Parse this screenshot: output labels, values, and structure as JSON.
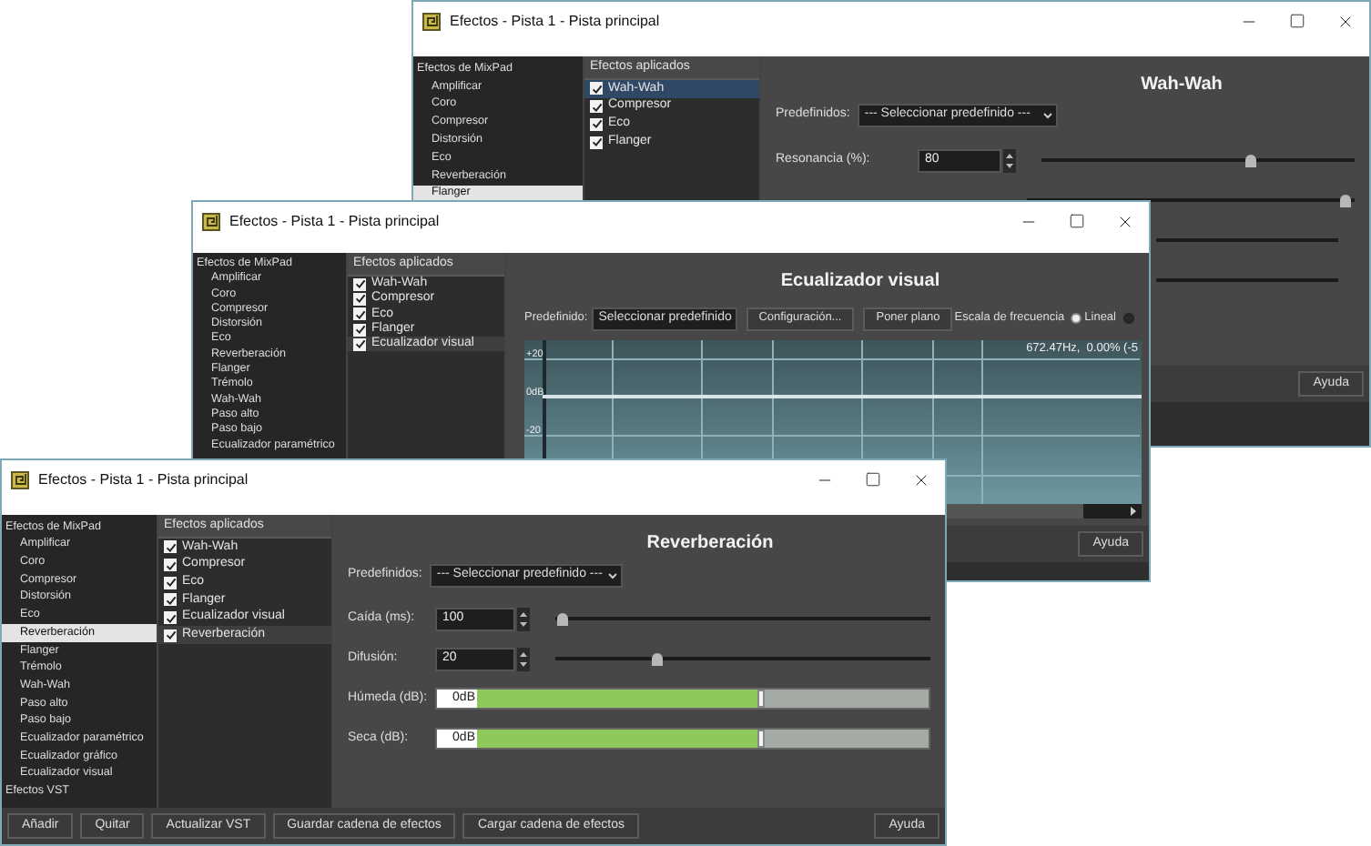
{
  "windows": [
    {
      "kind": "wah_wah",
      "title": "Efectos - Pista 1 - Pista principal",
      "tree": [
        {
          "label": "Efectos de MixPad",
          "selected": false,
          "children": [
            {
              "label": "Amplificar",
              "selected": false
            },
            {
              "label": "Coro",
              "selected": false
            },
            {
              "label": "Compresor",
              "selected": false
            },
            {
              "label": "Distorsión",
              "selected": false
            },
            {
              "label": "Eco",
              "selected": false
            },
            {
              "label": "Reverberación",
              "selected": false
            },
            {
              "label": "Flanger",
              "selected": true
            }
          ]
        }
      ],
      "applied_header": "Efectos aplicados",
      "applied": [
        {
          "label": "Wah-Wah",
          "checked": true,
          "selected": true
        },
        {
          "label": "Compresor",
          "checked": true,
          "selected": false
        },
        {
          "label": "Eco",
          "checked": true,
          "selected": false
        },
        {
          "label": "Flanger",
          "checked": true,
          "selected": false
        }
      ],
      "panel": {
        "title": "Wah-Wah",
        "preset_label": "Predefinidos:",
        "preset": "--- Seleccionar predefinido ---",
        "params": [
          {
            "kind": "slider",
            "label": "Resonancia (%):",
            "value": "80",
            "level": 0.67
          },
          {
            "kind": "slider",
            "level": 0.97
          }
        ]
      },
      "help_button": "Ayuda"
    },
    {
      "kind": "eq",
      "title": "Efectos - Pista 1 - Pista principal",
      "tree": [
        {
          "label": "Efectos de MixPad",
          "selected": false,
          "children": [
            {
              "label": "Amplificar",
              "selected": false
            },
            {
              "label": "Coro",
              "selected": false
            },
            {
              "label": "Compresor",
              "selected": false
            },
            {
              "label": "Distorsión",
              "selected": false
            },
            {
              "label": "Eco",
              "selected": false
            },
            {
              "label": "Reverberación",
              "selected": false
            },
            {
              "label": "Flanger",
              "selected": false
            },
            {
              "label": "Trémolo",
              "selected": false
            },
            {
              "label": "Wah-Wah",
              "selected": false
            },
            {
              "label": "Paso alto",
              "selected": false
            },
            {
              "label": "Paso bajo",
              "selected": false
            },
            {
              "label": "Ecualizador paramétrico",
              "selected": false
            }
          ]
        }
      ],
      "applied_header": "Efectos aplicados",
      "applied": [
        {
          "label": "Wah-Wah",
          "checked": true,
          "selected": false
        },
        {
          "label": "Compresor",
          "checked": true,
          "selected": false
        },
        {
          "label": "Eco",
          "checked": true,
          "selected": false
        },
        {
          "label": "Flanger",
          "checked": true,
          "selected": false
        },
        {
          "label": "Ecualizador visual",
          "checked": true,
          "selected": true
        }
      ],
      "panel": {
        "title": "Ecualizador visual",
        "preset_label": "Predefinido:",
        "preset": "Seleccionar predefinido",
        "buttons": [
          "Configuración...",
          "Poner plano"
        ],
        "scale_label": "Escala de frecuencia",
        "scale_options": [
          {
            "label": "Lineal",
            "selected": true
          },
          {
            "selected": false
          }
        ],
        "graph": {
          "y_labels": [
            "+20",
            "0dB",
            "-20"
          ],
          "readout": "672.47Hz,  0.00% (-5"
        }
      },
      "help_button": "Ayuda"
    },
    {
      "kind": "reverb",
      "title": "Efectos - Pista 1 - Pista principal",
      "tree": [
        {
          "label": "Efectos de MixPad",
          "selected": false,
          "children": [
            {
              "label": "Amplificar",
              "selected": false
            },
            {
              "label": "Coro",
              "selected": false
            },
            {
              "label": "Compresor",
              "selected": false
            },
            {
              "label": "Distorsión",
              "selected": false
            },
            {
              "label": "Eco",
              "selected": false
            },
            {
              "label": "Reverberación",
              "selected": true
            },
            {
              "label": "Flanger",
              "selected": false
            },
            {
              "label": "Trémolo",
              "selected": false
            },
            {
              "label": "Wah-Wah",
              "selected": false
            },
            {
              "label": "Paso alto",
              "selected": false
            },
            {
              "label": "Paso bajo",
              "selected": false
            },
            {
              "label": "Ecualizador paramétrico",
              "selected": false
            },
            {
              "label": "Ecualizador gráfico",
              "selected": false
            },
            {
              "label": "Ecualizador visual",
              "selected": false
            }
          ]
        },
        {
          "label": "Efectos VST",
          "selected": false
        }
      ],
      "applied_header": "Efectos aplicados",
      "applied": [
        {
          "label": "Wah-Wah",
          "checked": true,
          "selected": false
        },
        {
          "label": "Compresor",
          "checked": true,
          "selected": false
        },
        {
          "label": "Eco",
          "checked": true,
          "selected": false
        },
        {
          "label": "Flanger",
          "checked": true,
          "selected": false
        },
        {
          "label": "Ecualizador visual",
          "checked": true,
          "selected": false
        },
        {
          "label": "Reverberación",
          "checked": true,
          "selected": true
        }
      ],
      "panel": {
        "title": "Reverberación",
        "preset_label": "Predefinidos:",
        "preset": "--- Seleccionar predefinido ---",
        "params": [
          {
            "kind": "slider",
            "label": "Caída (ms):",
            "value": "100",
            "level": 0.02
          },
          {
            "kind": "slider",
            "label": "Difusión:",
            "value": "20",
            "level": 0.27
          },
          {
            "kind": "bar",
            "label": "Húmeda (dB):",
            "value": "0dB",
            "level": 0.66
          },
          {
            "kind": "bar",
            "label": "Seca (dB):",
            "value": "0dB",
            "level": 0.66
          }
        ]
      },
      "footer_buttons": [
        "Añadir",
        "Quitar",
        "Actualizar VST",
        "Guardar cadena de efectos",
        "Cargar cadena de efectos"
      ],
      "help_button": "Ayuda"
    }
  ]
}
